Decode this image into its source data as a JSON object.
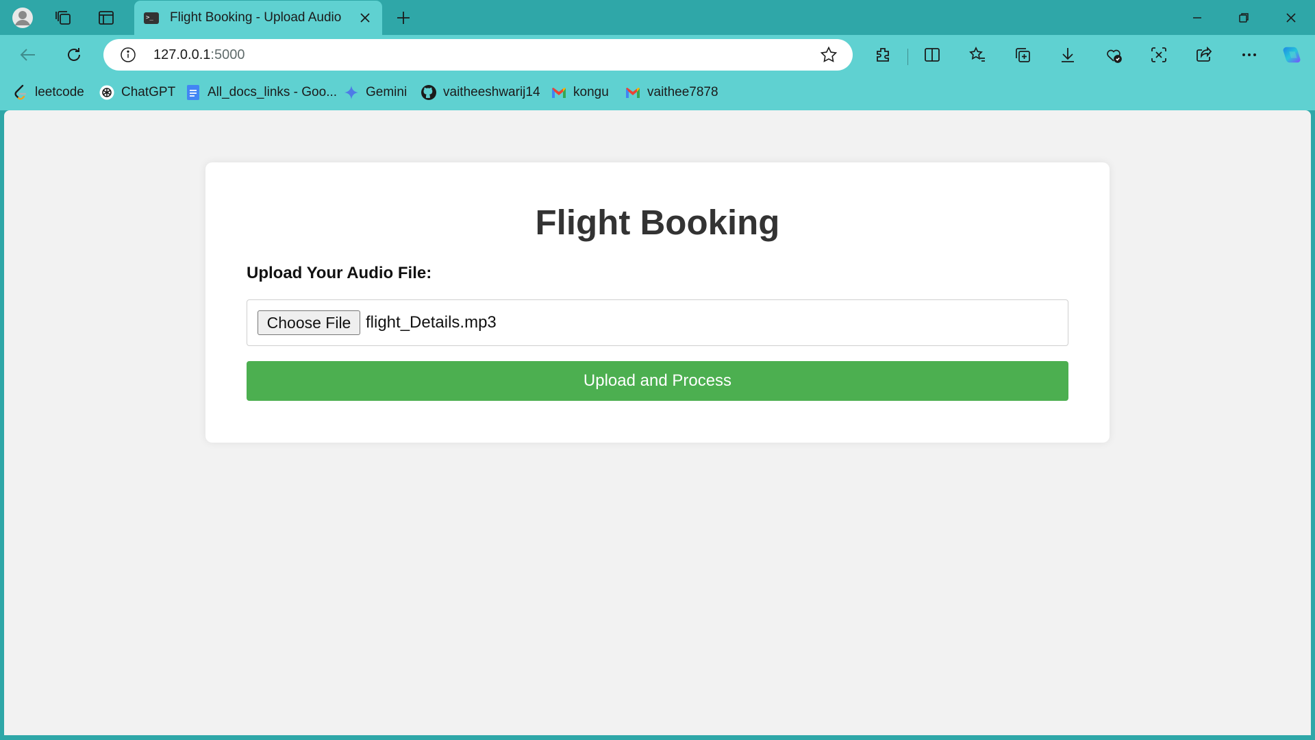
{
  "browser": {
    "tab": {
      "title": "Flight Booking - Upload Audio"
    },
    "address": {
      "host": "127.0.0.1",
      "port": ":5000"
    },
    "bookmarks": [
      {
        "label": "leetcode",
        "icon": "leetcode-icon"
      },
      {
        "label": "ChatGPT",
        "icon": "chatgpt-icon"
      },
      {
        "label": "All_docs_links - Goo...",
        "icon": "google-docs-icon"
      },
      {
        "label": "Gemini",
        "icon": "gemini-icon"
      },
      {
        "label": "vaitheeshwarij14",
        "icon": "github-icon"
      },
      {
        "label": "kongu",
        "icon": "gmail-icon"
      },
      {
        "label": "vaithee7878",
        "icon": "gmail-icon"
      }
    ]
  },
  "page": {
    "heading": "Flight Booking",
    "upload_label": "Upload Your Audio File:",
    "file_input": {
      "button_label": "Choose File",
      "selected_file": "flight_Details.mp3"
    },
    "submit_label": "Upload and Process"
  },
  "colors": {
    "titlebar": "#2fa7a8",
    "toolbar": "#5fd1d1",
    "submit_button": "#4caf50",
    "page_background": "#f2f2f2"
  }
}
